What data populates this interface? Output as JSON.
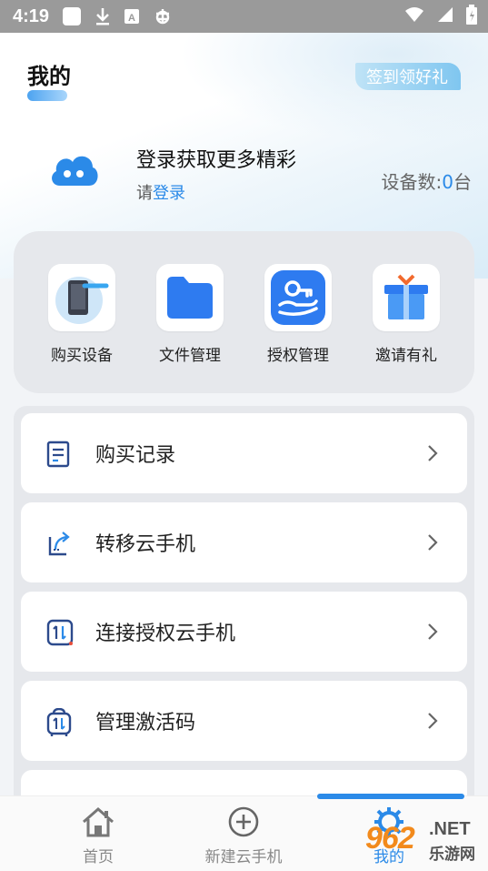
{
  "status_bar": {
    "time": "4:19"
  },
  "header": {
    "title": "我的",
    "signin_label": "签到领好礼"
  },
  "profile": {
    "login_title": "登录获取更多精彩",
    "login_prefix": "请",
    "login_link": "登录",
    "device_label": "设备数:",
    "device_count": "0",
    "device_unit": "台"
  },
  "quick_actions": [
    {
      "label": "购买设备",
      "icon": "phone-device-icon"
    },
    {
      "label": "文件管理",
      "icon": "folder-icon"
    },
    {
      "label": "授权管理",
      "icon": "key-hand-icon"
    },
    {
      "label": "邀请有礼",
      "icon": "gift-icon"
    }
  ],
  "menu": [
    {
      "label": "购买记录",
      "icon": "receipt-icon"
    },
    {
      "label": "转移云手机",
      "icon": "transfer-icon"
    },
    {
      "label": "连接授权云手机",
      "icon": "connect-icon"
    },
    {
      "label": "管理激活码",
      "icon": "activation-code-icon"
    }
  ],
  "tabs": [
    {
      "label": "首页",
      "icon": "home-icon"
    },
    {
      "label": "新建云手机",
      "icon": "plus-circle-icon"
    },
    {
      "label": "我的",
      "icon": "gear-icon"
    }
  ],
  "watermark": {
    "number": "962",
    "net": ".NET",
    "site": "乐游网"
  },
  "colors": {
    "accent": "#2b8ae8",
    "background": "#f2f4f7"
  }
}
